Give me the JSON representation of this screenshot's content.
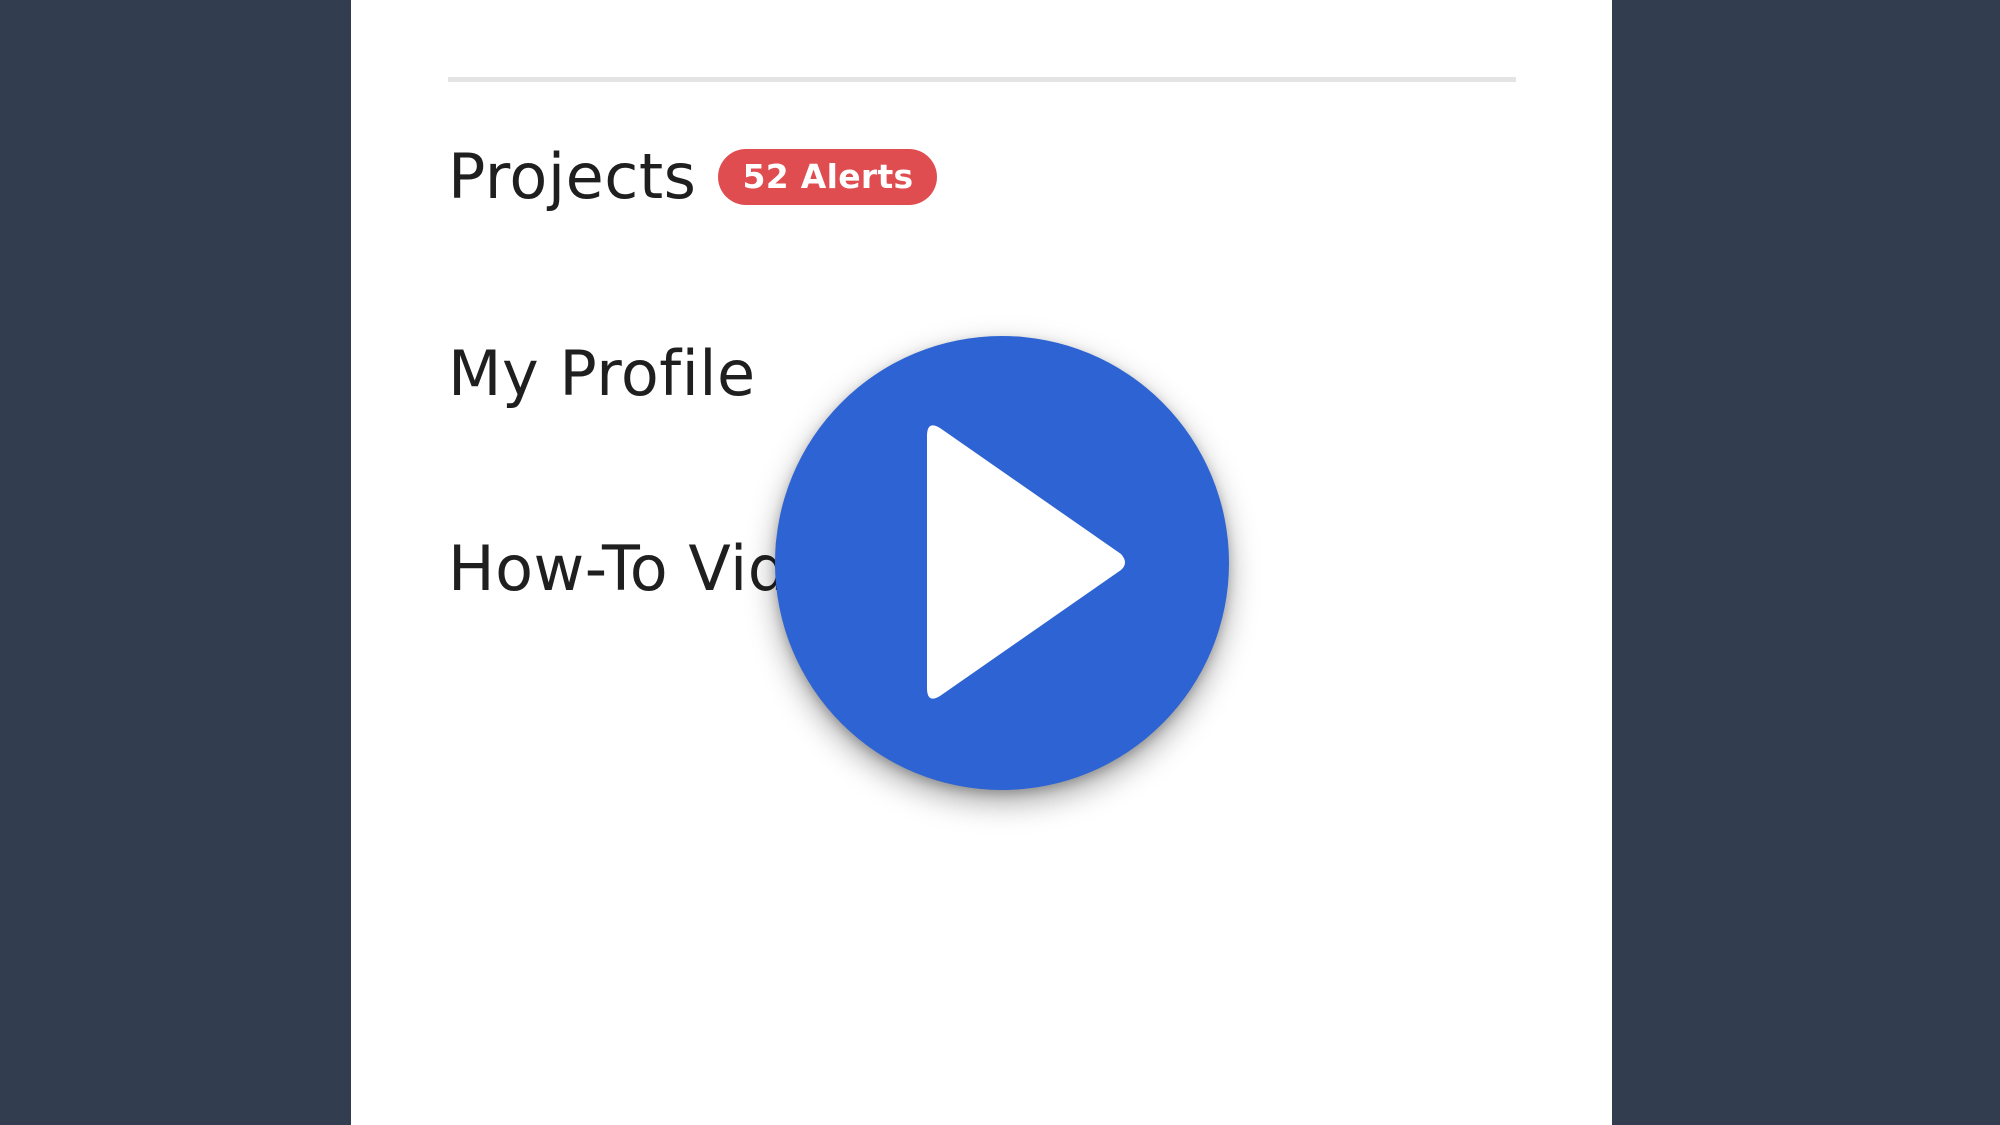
{
  "nav": {
    "projects": {
      "label": "Projects",
      "badge": "52 Alerts"
    },
    "profile": {
      "label": "My Profile"
    },
    "videos": {
      "label": "How-To Videos",
      "icon": "external-link-icon"
    }
  },
  "video_overlay": {
    "icon": "play-icon"
  },
  "colors": {
    "sidebar": "#323e4f",
    "panel": "#ffffff",
    "badge": "#e04d50",
    "accent": "#2d63d3",
    "text": "#1f1f1f",
    "divider": "#e4e4e4"
  }
}
